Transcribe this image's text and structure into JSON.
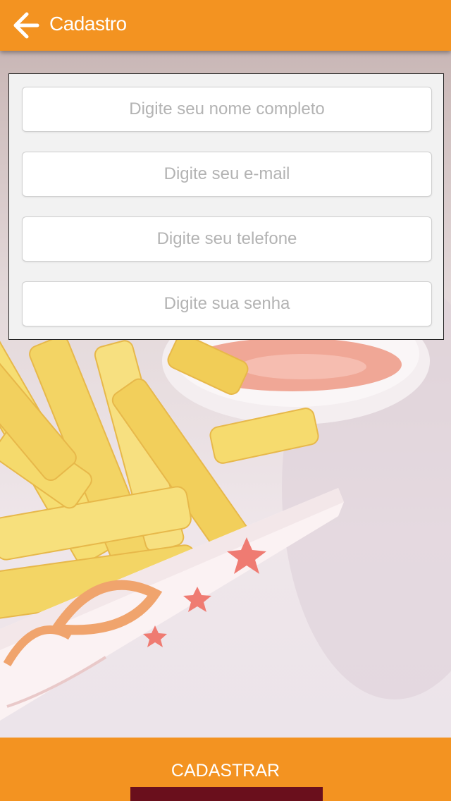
{
  "header": {
    "title": "Cadastro",
    "back_icon": "arrow-left-icon"
  },
  "form": {
    "fields": [
      {
        "name": "nome",
        "placeholder": "Digite seu nome completo",
        "value": ""
      },
      {
        "name": "email",
        "placeholder": "Digite seu e-mail",
        "value": ""
      },
      {
        "name": "telefone",
        "placeholder": "Digite seu telefone",
        "value": ""
      },
      {
        "name": "senha",
        "placeholder": "Digite sua senha",
        "value": ""
      }
    ]
  },
  "footer": {
    "submit_label": "CADASTRAR"
  },
  "colors": {
    "accent": "#f39321",
    "indicator": "#6a0f1c",
    "card": "#f2f2f2"
  }
}
